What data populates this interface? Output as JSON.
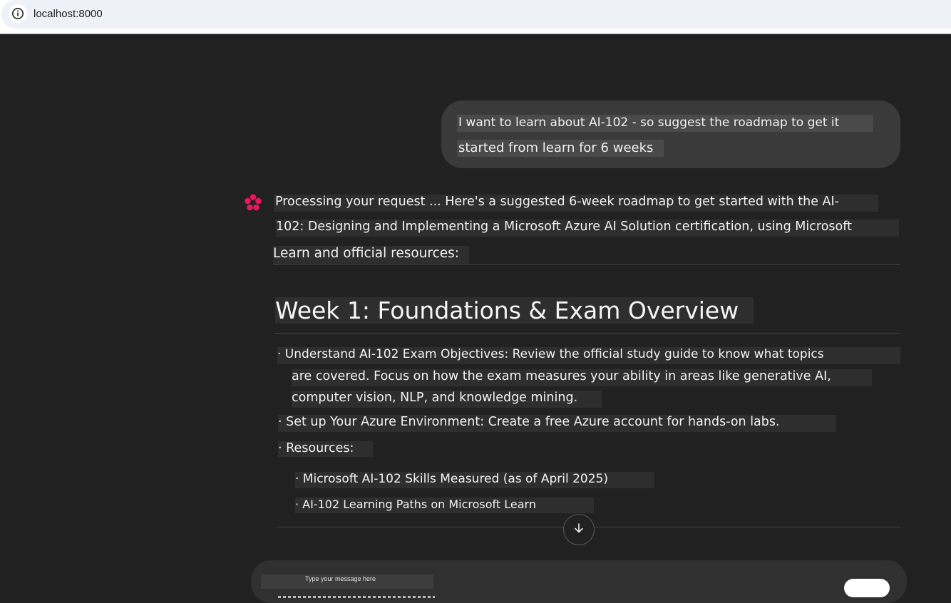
{
  "browser": {
    "url": "localhost:8000",
    "info_icon": "info-icon"
  },
  "chat": {
    "user_message": {
      "line1": "I want to learn about AI-102 - so suggest the roadmap to get it",
      "line2": "started from learn for 6 weeks"
    },
    "assistant": {
      "icon": "sparkle-logo-icon",
      "accent_color": "#e8175d",
      "intro_line1": "Processing your request ... Here's a suggested 6-week roadmap to get started with the AI-",
      "intro_line2": "102: Designing and Implementing a Microsoft Azure AI Solution certification, using Microsoft",
      "intro_line3": "Learn and official resources:",
      "week1_heading": "Week 1: Foundations & Exam Overview",
      "bullets": [
        {
          "line1": "· Understand AI-102 Exam Objectives: Review the official study guide to know what topics",
          "line2": "are covered. Focus on how the exam measures your ability in areas like generative AI,",
          "line3": "computer vision, NLP, and knowledge mining."
        },
        {
          "line1": "· Set up Your Azure Environment: Create a free Azure account for hands-on labs."
        },
        {
          "line1": "· Resources:"
        }
      ],
      "resources": [
        "· Microsoft AI-102 Skills Measured (as of April 2025)",
        "· AI-102 Learning Paths on Microsoft Learn"
      ]
    },
    "scroll_down_icon": "arrow-down-icon"
  },
  "composer": {
    "placeholder": "Type your message here"
  }
}
